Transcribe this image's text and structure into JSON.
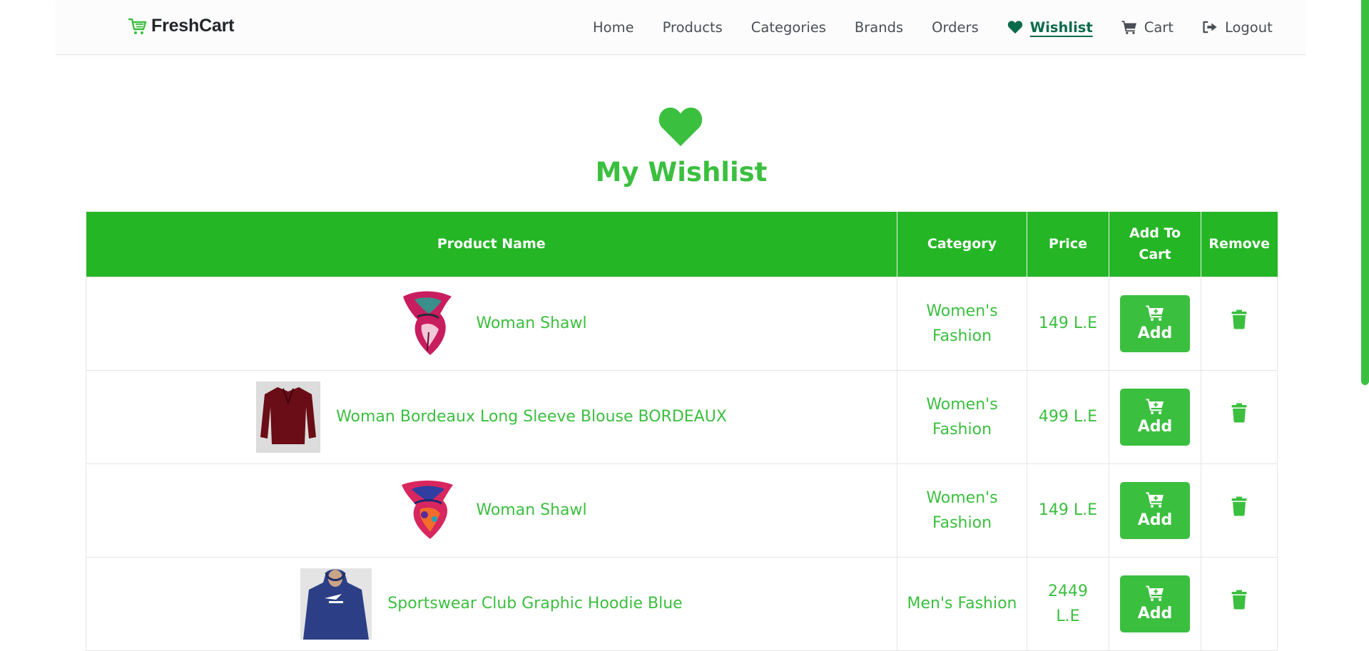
{
  "brand": {
    "name": "FreshCart"
  },
  "nav": {
    "items": [
      {
        "label": "Home"
      },
      {
        "label": "Products"
      },
      {
        "label": "Categories"
      },
      {
        "label": "Brands"
      },
      {
        "label": "Orders"
      },
      {
        "label": "Wishlist",
        "icon": "heart-icon",
        "active": true
      },
      {
        "label": "Cart",
        "icon": "cart-icon"
      },
      {
        "label": "Logout",
        "icon": "logout-icon"
      }
    ]
  },
  "page": {
    "title": "My Wishlist",
    "icon": "heart-icon"
  },
  "table": {
    "headers": [
      "Product Name",
      "Category",
      "Price",
      "Add To Cart",
      "Remove"
    ],
    "add_label": "Add",
    "rows": [
      {
        "name": "Woman Shawl",
        "category": "Women's Fashion",
        "price": "149 L.E",
        "image": "shawl-pink"
      },
      {
        "name": "Woman Bordeaux Long Sleeve Blouse BORDEAUX",
        "category": "Women's Fashion",
        "price": "499 L.E",
        "image": "blouse-bordeaux"
      },
      {
        "name": "Woman Shawl",
        "category": "Women's Fashion",
        "price": "149 L.E",
        "image": "shawl-colorful"
      },
      {
        "name": "Sportswear Club Graphic Hoodie Blue",
        "category": "Men's Fashion",
        "price": "2449 L.E",
        "image": "hoodie-blue"
      }
    ]
  },
  "colors": {
    "brand_green": "#3bbf3f",
    "header_green": "#25b626",
    "active_nav": "#0a6b4a"
  }
}
